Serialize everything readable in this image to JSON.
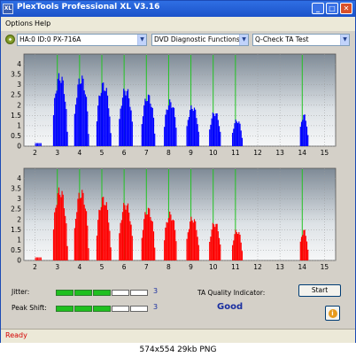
{
  "window": {
    "title": "PlexTools Professional XL V3.16",
    "app_icon": "XL",
    "buttons": {
      "minimize": "_",
      "maximize": "□",
      "close": "✕"
    }
  },
  "menu": {
    "items": [
      "Options",
      "Help"
    ]
  },
  "toolbar": {
    "drive": "HA:0 ID:0  PX-716A",
    "function": "DVD Diagnostic Functions",
    "test": "Q-Check TA Test",
    "icon": "disc-drive-icon"
  },
  "chart_data": [
    {
      "type": "bar",
      "title": "",
      "series_color": "#0000ff",
      "x_ticks": [
        2,
        3,
        4,
        5,
        6,
        7,
        8,
        9,
        10,
        11,
        12,
        13,
        14,
        15
      ],
      "y_ticks": [
        0,
        0.5,
        1,
        1.5,
        2,
        2.5,
        3,
        3.5,
        4
      ],
      "xlim": [
        1.5,
        15.5
      ],
      "ylim": [
        0,
        4.5
      ],
      "grid": true,
      "markers_x": [
        3,
        4,
        5,
        6,
        7,
        8,
        9,
        10,
        11,
        14
      ],
      "peaks": [
        {
          "center": 3.1,
          "height": 3.65,
          "width": 0.34
        },
        {
          "center": 4.05,
          "height": 3.55,
          "width": 0.34
        },
        {
          "center": 5.05,
          "height": 3.2,
          "width": 0.34
        },
        {
          "center": 6.05,
          "height": 2.95,
          "width": 0.33
        },
        {
          "center": 7.05,
          "height": 2.6,
          "width": 0.32
        },
        {
          "center": 8.05,
          "height": 2.3,
          "width": 0.31
        },
        {
          "center": 9.05,
          "height": 2.05,
          "width": 0.3
        },
        {
          "center": 10.05,
          "height": 1.75,
          "width": 0.28
        },
        {
          "center": 11.05,
          "height": 1.35,
          "width": 0.25
        },
        {
          "center": 14.05,
          "height": 1.6,
          "width": 0.2
        }
      ]
    },
    {
      "type": "bar",
      "title": "",
      "series_color": "#ff0000",
      "x_ticks": [
        2,
        3,
        4,
        5,
        6,
        7,
        8,
        9,
        10,
        11,
        12,
        13,
        14,
        15
      ],
      "y_ticks": [
        0,
        0.5,
        1,
        1.5,
        2,
        2.5,
        3,
        3.5,
        4
      ],
      "xlim": [
        1.5,
        15.5
      ],
      "ylim": [
        0,
        4.5
      ],
      "grid": true,
      "markers_x": [
        3,
        4,
        5,
        6,
        7,
        8,
        9,
        10,
        11,
        14
      ],
      "peaks": [
        {
          "center": 3.1,
          "height": 3.65,
          "width": 0.34
        },
        {
          "center": 4.05,
          "height": 3.55,
          "width": 0.34
        },
        {
          "center": 5.05,
          "height": 3.2,
          "width": 0.34
        },
        {
          "center": 6.05,
          "height": 2.95,
          "width": 0.33
        },
        {
          "center": 7.05,
          "height": 2.65,
          "width": 0.32
        },
        {
          "center": 8.05,
          "height": 2.4,
          "width": 0.31
        },
        {
          "center": 9.05,
          "height": 2.2,
          "width": 0.3
        },
        {
          "center": 10.05,
          "height": 1.95,
          "width": 0.28
        },
        {
          "center": 11.05,
          "height": 1.55,
          "width": 0.25
        },
        {
          "center": 14.05,
          "height": 1.55,
          "width": 0.2
        }
      ]
    }
  ],
  "metrics": {
    "jitter": {
      "label": "Jitter:",
      "value": "3",
      "filled": 3,
      "segments": 5
    },
    "peak_shift": {
      "label": "Peak Shift:",
      "value": "3",
      "filled": 3,
      "segments": 5
    }
  },
  "quality": {
    "label": "TA Quality Indicator:",
    "result": "Good"
  },
  "actions": {
    "start": "Start",
    "info_icon": "i"
  },
  "status": {
    "text": "Ready"
  },
  "caption": "574x554  29kb  PNG"
}
